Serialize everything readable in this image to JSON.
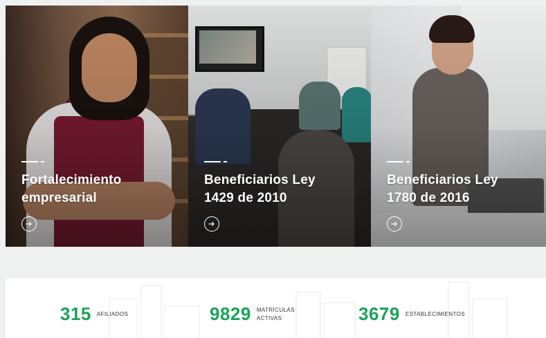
{
  "cards": [
    {
      "title": "Fortalecimiento\nempresarial",
      "action_icon": "arrow-right-icon"
    },
    {
      "title": "Beneficiarios Ley\n1429 de 2010",
      "action_icon": "arrow-right-icon"
    },
    {
      "title": "Beneficiarios Ley\n1780 de 2016",
      "action_icon": "arrow-right-icon"
    }
  ],
  "stats": [
    {
      "number": "315",
      "label": "AFILIADOS"
    },
    {
      "number": "9829",
      "label": "MATRÍCULAS\nACTIVAS"
    },
    {
      "number": "3679",
      "label": "ESTABLECIMIENTOS"
    }
  ],
  "colors": {
    "accent": "#1aa358",
    "page_bg": "#eef1f0"
  }
}
